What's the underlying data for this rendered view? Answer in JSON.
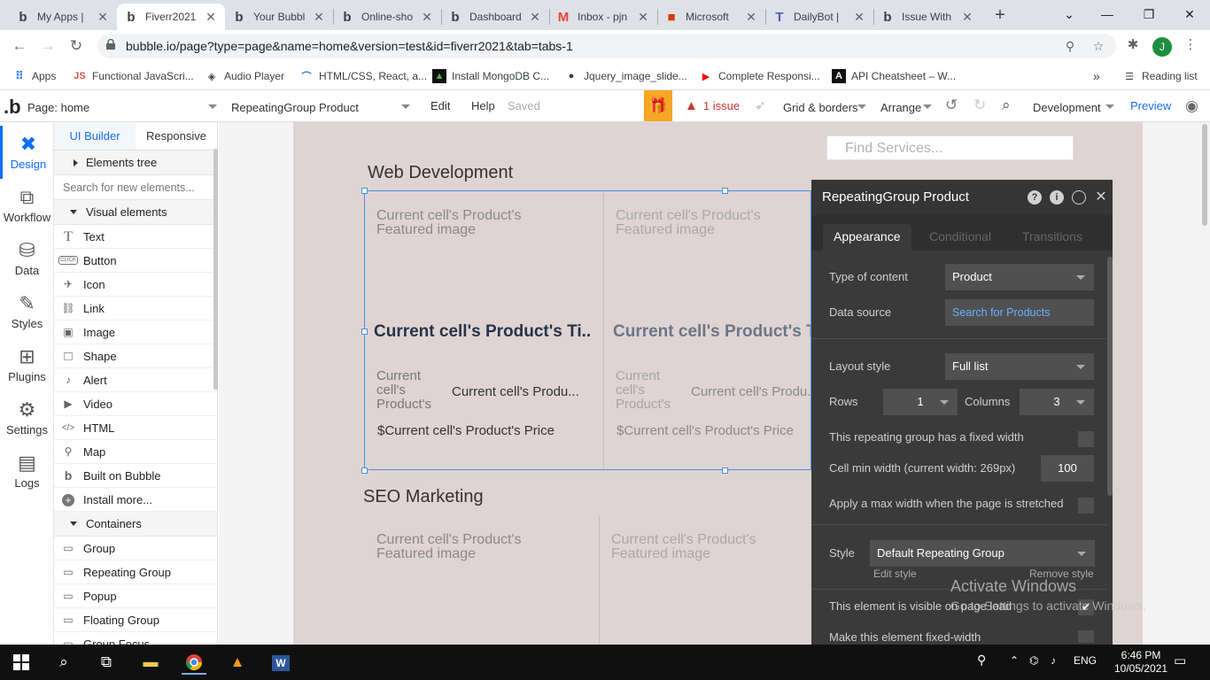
{
  "browser": {
    "tabs": [
      {
        "title": "My Apps |",
        "favicon": "bubble-b-icon",
        "active": false
      },
      {
        "title": "Fiverr2021",
        "favicon": "bubble-b-icon",
        "active": true
      },
      {
        "title": "Your Bubbl",
        "favicon": "bubble-b-icon",
        "active": false
      },
      {
        "title": "Online-sho",
        "favicon": "bubble-b-icon",
        "active": false
      },
      {
        "title": "Dashboard",
        "favicon": "bubble-b-icon",
        "active": false
      },
      {
        "title": "Inbox - pjn",
        "favicon": "gmail-icon",
        "active": false
      },
      {
        "title": "Microsoft",
        "favicon": "office-icon",
        "active": false
      },
      {
        "title": "DailyBot |",
        "favicon": "teams-icon",
        "active": false
      },
      {
        "title": "Issue With",
        "favicon": "bubble-b-icon",
        "active": false
      }
    ],
    "url": "bubble.io/page?type=page&name=home&version=test&id=fiverr2021&tab=tabs-1",
    "profile_initial": "J",
    "bookmarks": [
      {
        "label": "Apps",
        "icon": "apps-grid-icon"
      },
      {
        "label": "Functional JavaScri...",
        "icon": "js-icon"
      },
      {
        "label": "Audio Player",
        "icon": "codepen-icon"
      },
      {
        "label": "HTML/CSS, React, a...",
        "icon": "rainbow-icon"
      },
      {
        "label": "Install MongoDB C...",
        "icon": "mongodb-icon"
      },
      {
        "label": "Jquery_image_slide...",
        "icon": "github-icon"
      },
      {
        "label": "Complete Responsi...",
        "icon": "youtube-icon"
      },
      {
        "label": "API Cheatsheet – W...",
        "icon": "dev-icon"
      }
    ],
    "bookmarks_more": "»",
    "reading_list": "Reading list"
  },
  "bubble_header": {
    "page_label": "Page: home",
    "element_label": "RepeatingGroup Product",
    "edit": "Edit",
    "help": "Help",
    "saved": "Saved",
    "issue": "1 issue",
    "grid_borders": "Grid & borders",
    "arrange": "Arrange",
    "environment": "Development",
    "preview": "Preview"
  },
  "rail": [
    {
      "label": "Design",
      "icon": "design-icon",
      "active": true
    },
    {
      "label": "Workflow",
      "icon": "workflow-icon",
      "active": false
    },
    {
      "label": "Data",
      "icon": "database-icon",
      "active": false
    },
    {
      "label": "Styles",
      "icon": "brush-icon",
      "active": false
    },
    {
      "label": "Plugins",
      "icon": "plugin-icon",
      "active": false
    },
    {
      "label": "Settings",
      "icon": "gear-icon",
      "active": false
    },
    {
      "label": "Logs",
      "icon": "log-icon",
      "active": false
    }
  ],
  "panel": {
    "tab_ui_builder": "UI Builder",
    "tab_responsive": "Responsive",
    "elements_tree": "Elements tree",
    "search_placeholder": "Search for new elements...",
    "visual_elements": "Visual elements",
    "visual_items": [
      {
        "label": "Text",
        "icon": "T"
      },
      {
        "label": "Button",
        "icon": "CLICK"
      },
      {
        "label": "Icon",
        "icon": "✈"
      },
      {
        "label": "Link",
        "icon": "🔗"
      },
      {
        "label": "Image",
        "icon": "▣"
      },
      {
        "label": "Shape",
        "icon": "□"
      },
      {
        "label": "Alert",
        "icon": "🔔"
      },
      {
        "label": "Video",
        "icon": "▶"
      },
      {
        "label": "HTML",
        "icon": "</>"
      },
      {
        "label": "Map",
        "icon": "📍"
      },
      {
        "label": "Built on Bubble",
        "icon": "b"
      },
      {
        "label": "Install more...",
        "icon": "+"
      }
    ],
    "containers": "Containers",
    "container_items": [
      {
        "label": "Group",
        "icon": "▭"
      },
      {
        "label": "Repeating Group",
        "icon": "▭"
      },
      {
        "label": "Popup",
        "icon": "▭"
      },
      {
        "label": "Floating Group",
        "icon": "▭"
      },
      {
        "label": "Group Focus",
        "icon": "▭"
      }
    ]
  },
  "canvas": {
    "find_placeholder": "Find Services...",
    "section1_title": "Web Development",
    "section2_title": "SEO Marketing",
    "cell_image": "Current cell's Product's Featured image",
    "cell_title": "Current cell's Product's Ti...",
    "cell_small": "Current cell's Product's",
    "cell_desc": "Current cell's Produ...",
    "cell_price": "$Current cell's Product's Price"
  },
  "property_editor": {
    "title": "RepeatingGroup Product",
    "tabs": {
      "appearance": "Appearance",
      "conditional": "Conditional",
      "transitions": "Transitions"
    },
    "type_of_content_label": "Type of content",
    "type_of_content_value": "Product",
    "data_source_label": "Data source",
    "data_source_value": "Search for Products",
    "layout_style_label": "Layout style",
    "layout_style_value": "Full list",
    "rows_label": "Rows",
    "rows_value": "1",
    "columns_label": "Columns",
    "columns_value": "3",
    "fixed_width_label": "This repeating group has a fixed width",
    "cell_min_width_label": "Cell min width (current width: 269px)",
    "cell_min_width_value": "100",
    "max_width_label": "Apply a max width when the page is stretched",
    "style_label": "Style",
    "style_value": "Default Repeating Group",
    "edit_style": "Edit style",
    "remove_style": "Remove style",
    "visible_label": "This element is visible on page load",
    "fixed_element_label": "Make this element fixed-width"
  },
  "watermark": {
    "line1": "Activate Windows",
    "line2": "Go to Settings to activate Windows."
  },
  "taskbar": {
    "lang": "ENG",
    "time": "6:46 PM",
    "date": "10/05/2021"
  },
  "colors": {
    "bubble_blue": "#0d6efd",
    "page_bg": "#dfd3d3",
    "prop_bg": "#3a3a3a",
    "gift": "#f5a623"
  }
}
